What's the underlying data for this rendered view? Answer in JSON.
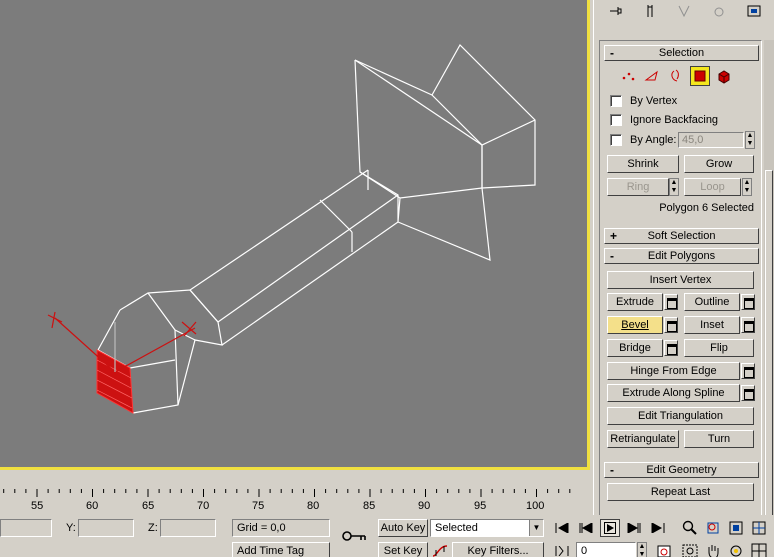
{
  "viewport": {
    "bg_color": "#7c7c7c",
    "border_color": "#f0e040",
    "wire_color": "#ffffff",
    "selection_color": "#cc1111"
  },
  "command_panel": {
    "tab_icons": [
      "pin-icon",
      "hierarchy-icon",
      "motion-icon",
      "display-icon",
      "utilities-icon"
    ],
    "selection": {
      "header": "Selection",
      "level_icons": [
        "vertex-icon",
        "edge-icon",
        "border-icon",
        "polygon-icon",
        "element-icon"
      ],
      "by_vertex": "By Vertex",
      "ignore_backfacing": "Ignore Backfacing",
      "by_angle": "By Angle:",
      "angle_value": "45,0",
      "shrink": "Shrink",
      "grow": "Grow",
      "ring": "Ring",
      "loop": "Loop",
      "status": "Polygon 6 Selected"
    },
    "soft_selection": {
      "header": "Soft Selection"
    },
    "edit_polygons": {
      "header": "Edit Polygons",
      "insert_vertex": "Insert Vertex",
      "extrude": "Extrude",
      "outline": "Outline",
      "bevel": "Bevel",
      "inset": "Inset",
      "bridge": "Bridge",
      "flip": "Flip",
      "hinge": "Hinge From Edge",
      "extrude_spline": "Extrude Along Spline",
      "edit_triangulation": "Edit Triangulation",
      "retriangulate": "Retriangulate",
      "turn": "Turn"
    },
    "edit_geometry": {
      "header": "Edit Geometry",
      "repeat_last": "Repeat Last"
    }
  },
  "timeline": {
    "ticks": [
      "55",
      "60",
      "65",
      "70",
      "75",
      "80",
      "85",
      "90",
      "95",
      "100"
    ]
  },
  "status_bar": {
    "y_label": "Y:",
    "z_label": "Z:",
    "grid": "Grid = 0,0",
    "add_time_tag": "Add Time Tag",
    "auto_key": "Auto Key",
    "set_key": "Set Key",
    "selected": "Selected",
    "key_filters": "Key Filters...",
    "frame": "0"
  }
}
